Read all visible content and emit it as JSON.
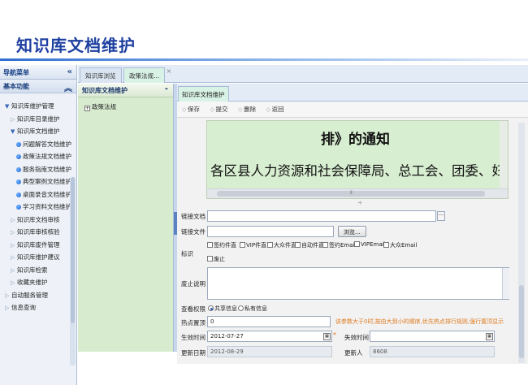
{
  "slide_title": "知识库文档维护",
  "nav": {
    "header": "导航菜单",
    "collapse_icon": "«",
    "section": "基本功能",
    "items": [
      {
        "label": "知识库维护管理",
        "level": 0,
        "type": "open"
      },
      {
        "label": "知识库目录维护",
        "level": 1,
        "type": "closed"
      },
      {
        "label": "知识库文档维护",
        "level": 1,
        "type": "open"
      },
      {
        "label": "问题解答文档维护",
        "level": 2,
        "type": "dot"
      },
      {
        "label": "政策法规文档维护",
        "level": 2,
        "type": "dot"
      },
      {
        "label": "服务指南文档维护",
        "level": 2,
        "type": "dot"
      },
      {
        "label": "典型案例文档维护",
        "level": 2,
        "type": "dot"
      },
      {
        "label": "桌面录音文档维护",
        "level": 2,
        "type": "dot"
      },
      {
        "label": "学习资料文档维护",
        "level": 2,
        "type": "dot"
      },
      {
        "label": "知识库文档审核",
        "level": 1,
        "type": "closed"
      },
      {
        "label": "知识库审核核验",
        "level": 1,
        "type": "closed"
      },
      {
        "label": "知识库废件管理",
        "level": 1,
        "type": "closed"
      },
      {
        "label": "知识库维护建议",
        "level": 1,
        "type": "closed"
      },
      {
        "label": "知识库检索",
        "level": 1,
        "type": "closed"
      },
      {
        "label": "收藏夹维护",
        "level": 1,
        "type": "closed"
      },
      {
        "label": "自动服务管理",
        "level": 0,
        "type": "closed"
      },
      {
        "label": "信息查询",
        "level": 0,
        "type": "closed"
      }
    ]
  },
  "tabs": [
    {
      "label": "知识库浏览"
    },
    {
      "label": "政策法规...",
      "close": "×"
    }
  ],
  "tree": {
    "header": "知识库文档维护",
    "collapse_icon": "-",
    "node": "政策法规"
  },
  "main": {
    "tab": "知识库文档维护",
    "toolbar": [
      "保存",
      "提交",
      "删除",
      "返回"
    ],
    "editor": {
      "line1": "排》的通知",
      "line2": "各区县人力资源和社会保障局、总工会、团委、妇"
    },
    "form": {
      "link_doc_label": "链接文档",
      "link_file_label": "链接文件",
      "browse_label": "浏览...",
      "tags_label": "标识",
      "tags": [
        "签约件直",
        "VIP件直",
        "大众件直",
        "自动件直",
        "签约Email",
        "VIPEmail",
        "大众Email",
        "废止"
      ],
      "abolish_note_label": "废止说明",
      "permission_label": "查看权限",
      "permission_options": [
        {
          "label": "共享信息",
          "selected": true
        },
        {
          "label": "私有信息",
          "selected": false
        }
      ],
      "hot_top_label": "热点置顶",
      "hot_top_value": "0",
      "hot_top_hint": "该参数大于0时,按由大到小的顺序,优先热点排行规则,强行置顶显示",
      "effective_label": "生效时间",
      "effective_value": "2012-07-27",
      "expire_label": "失效时间",
      "expire_value": "",
      "updated_label": "更新日期",
      "updated_value": "2012-08-29",
      "updater_label": "更新人",
      "updater_value": "8608"
    }
  }
}
